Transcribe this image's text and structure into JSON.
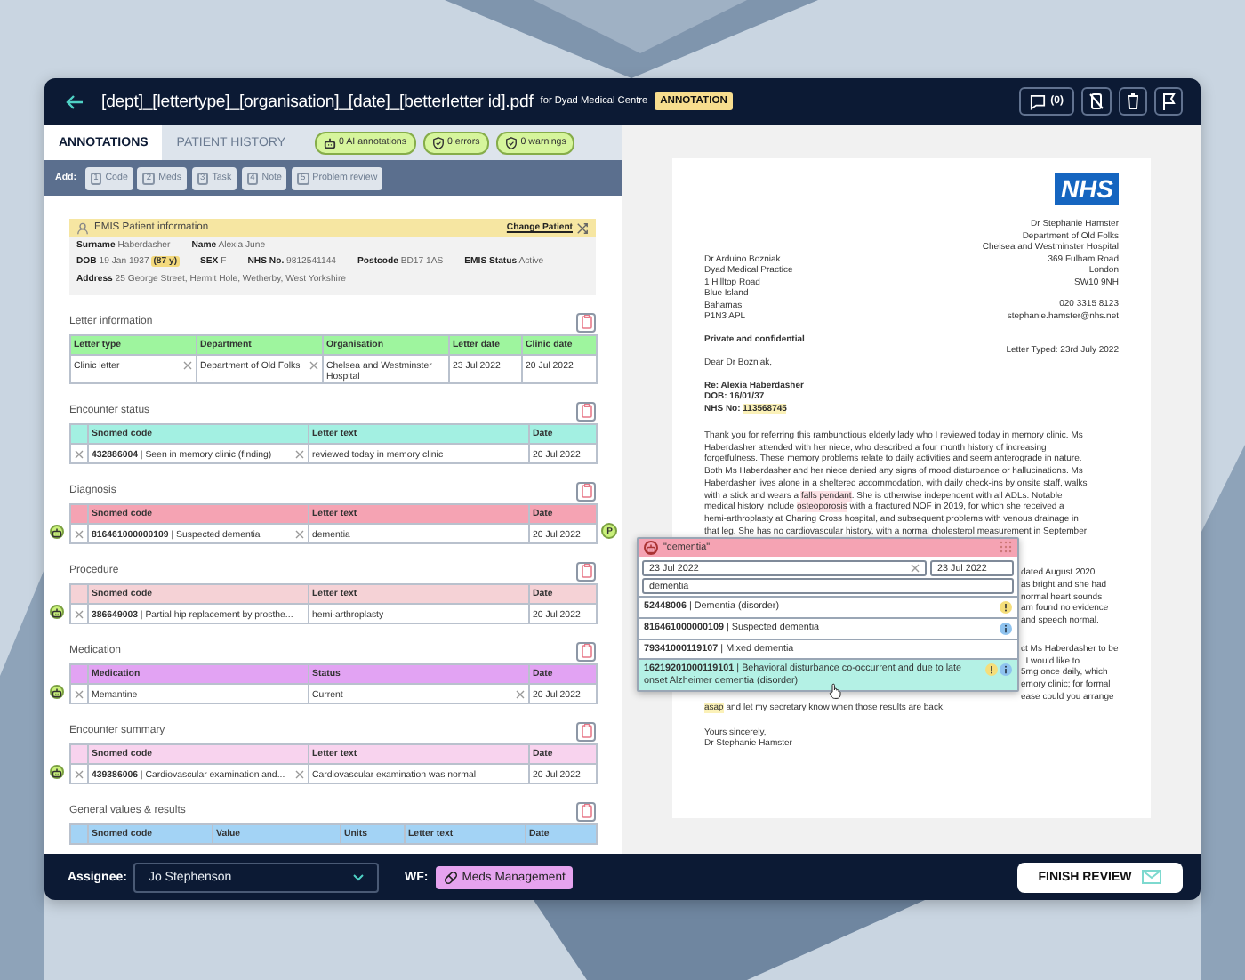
{
  "header": {
    "title": "[dept]_[lettertype]_[organisation]_[date]_[betterletter id].pdf",
    "subtitle": "for Dyad Medical Centre",
    "badge": "ANNOTATION",
    "comment_count": "(0)"
  },
  "tabs": [
    {
      "label": "ANNOTATIONS",
      "selected": true
    },
    {
      "label": "PATIENT HISTORY",
      "selected": false
    }
  ],
  "summary_pills": [
    {
      "kind": "ai",
      "label": "0 AI annotations"
    },
    {
      "kind": "error",
      "label": "0 errors"
    },
    {
      "kind": "warning",
      "label": "0 warnings"
    }
  ],
  "add_bar": {
    "label": "Add:",
    "items": [
      {
        "key": "1",
        "label": "Code"
      },
      {
        "key": "2",
        "label": "Meds"
      },
      {
        "key": "3",
        "label": "Task"
      },
      {
        "key": "4",
        "label": "Note"
      },
      {
        "key": "5",
        "label": "Problem review"
      }
    ]
  },
  "patient": {
    "title": "EMIS Patient information",
    "change": "Change Patient",
    "rows": [
      [
        {
          "label": "Surname",
          "value": "Haberdasher"
        },
        {
          "label": "Name",
          "value": "Alexia June"
        }
      ],
      [
        {
          "label": "DOB",
          "value": "19 Jan 1937",
          "badge": "(87 y)"
        },
        {
          "label": "SEX",
          "value": "F"
        },
        {
          "label": "NHS No.",
          "value": "9812541144"
        },
        {
          "label": "Postcode",
          "value": "BD17 1AS"
        },
        {
          "label": "EMIS Status",
          "value": "Active"
        }
      ],
      [
        {
          "label": "Address",
          "value": "25 George Street, Hermit Hole, Wetherby, West Yorkshire"
        }
      ]
    ]
  },
  "sections": [
    {
      "title": "Letter information",
      "kind": "letter",
      "color": "#9ef59e",
      "removable_rows": false,
      "ai_suggested": false,
      "columns": [
        "Letter type",
        "Department",
        "Organisation",
        "Letter date",
        "Clinic date"
      ],
      "rows": [
        [
          {
            "text": "Clinic letter",
            "clearable": true
          },
          {
            "text": "Department of Old Folks",
            "clearable": true
          },
          {
            "text": "Chelsea and Westminster Hospital"
          },
          {
            "text": "23 Jul 2022"
          },
          {
            "text": "20 Jul 2022"
          }
        ]
      ]
    },
    {
      "title": "Encounter status",
      "kind": "coded",
      "color": "#a3f0e2",
      "removable_rows": true,
      "ai_suggested": false,
      "columns": [
        "Snomed code",
        "Letter text",
        "Date"
      ],
      "rows": [
        [
          {
            "text": "**432886004** | Seen in memory clinic (finding)",
            "clearable": true
          },
          {
            "text": "reviewed today in memory clinic"
          },
          {
            "text": "20 Jul 2022"
          }
        ]
      ]
    },
    {
      "title": "Diagnosis",
      "kind": "coded",
      "color": "#f5a3b3",
      "removable_rows": true,
      "ai_suggested": true,
      "priority": "P",
      "columns": [
        "Snomed code",
        "Letter text",
        "Date"
      ],
      "rows": [
        [
          {
            "text": "**816461000000109** | Suspected dementia",
            "clearable": true
          },
          {
            "text": "dementia"
          },
          {
            "text": "20 Jul 2022"
          }
        ]
      ]
    },
    {
      "title": "Procedure",
      "kind": "coded",
      "color": "#f5d2d6",
      "removable_rows": true,
      "ai_suggested": true,
      "columns": [
        "Snomed code",
        "Letter text",
        "Date"
      ],
      "rows": [
        [
          {
            "text": "**386649003** | Partial hip replacement by prosthe..."
          },
          {
            "text": "hemi-arthroplasty"
          },
          {
            "text": "20 Jul 2022"
          }
        ]
      ]
    },
    {
      "title": "Medication",
      "kind": "coded",
      "color": "#e2a3f3",
      "removable_rows": true,
      "ai_suggested": true,
      "columns": [
        "Medication",
        "Status",
        "Date"
      ],
      "rows": [
        [
          {
            "text": "Memantine"
          },
          {
            "text": "Current",
            "clearable": true
          },
          {
            "text": "20 Jul 2022"
          }
        ]
      ]
    },
    {
      "title": "Encounter summary",
      "kind": "coded",
      "color": "#f8d3ee",
      "removable_rows": true,
      "ai_suggested": true,
      "columns": [
        "Snomed code",
        "Letter text",
        "Date"
      ],
      "rows": [
        [
          {
            "text": "**439386006** | Cardiovascular examination and...",
            "clearable": true
          },
          {
            "text": "Cardiovascular examination was normal"
          },
          {
            "text": "20 Jul 2022"
          }
        ]
      ]
    },
    {
      "title": "General values & results",
      "kind": "values",
      "color": "#a3d3f5",
      "removable_rows": true,
      "ai_suggested": false,
      "columns": [
        "Snomed code",
        "Value",
        "Units",
        "Letter text",
        "Date"
      ]
    }
  ],
  "document": {
    "logo": "NHS",
    "sender": [
      "Dr Stephanie Hamster",
      "Department of Old Folks",
      "Chelsea and Westminster Hospital",
      "369 Fulham Road",
      "London",
      "SW10 9NH"
    ],
    "contact": [
      "020 3315 8123",
      "stephanie.hamster@nhs.net"
    ],
    "recipient": [
      "Dr Arduino Bozniak",
      "Dyad Medical Practice",
      "1 Hilltop Road",
      "Blue Island",
      "Bahamas",
      "P1N3 APL"
    ],
    "private": "Private and confidential",
    "typed": "Letter Typed: 23rd July 2022",
    "greeting": "Dear Dr Bozniak,",
    "re": [
      {
        "label": "Re:",
        "value": "Alexia Haberdasher",
        "highlight": false
      },
      {
        "label": "DOB:",
        "value": "16/01/37",
        "highlight": false
      },
      {
        "label": "NHS No:",
        "value": "113568745",
        "highlight": true
      }
    ],
    "paragraphs": [
      [
        {
          "kind": "full",
          "parts": [
            {
              "text": "Thank you for referring this rambunctious elderly lady who I reviewed today in memory clinic. Ms"
            }
          ]
        },
        {
          "kind": "full",
          "parts": [
            {
              "text": "Haberdasher attended with her niece, who described a four month history of increasing"
            }
          ]
        },
        {
          "kind": "full",
          "parts": [
            {
              "text": "forgetfulness. These memory problems relate to daily activities and seem anterograde in nature."
            }
          ]
        },
        {
          "kind": "full",
          "parts": [
            {
              "text": "Both Ms Haberdasher and her niece denied any signs of mood disturbance or hallucinations. Ms"
            }
          ]
        },
        {
          "kind": "full",
          "parts": [
            {
              "text": "Haberdasher lives alone in a sheltered accommodation, with daily check-ins by onsite staff, walks"
            }
          ]
        },
        {
          "kind": "full",
          "parts": [
            {
              "text": "with a stick and wears a "
            },
            {
              "text": "falls pendant",
              "color": "#fde2e6"
            },
            {
              "text": ". She is otherwise independent with all ADLs. Notable"
            }
          ]
        },
        {
          "kind": "full",
          "parts": [
            {
              "text": "medical history include "
            },
            {
              "text": "osteoporosis",
              "color": "#fde2e6"
            },
            {
              "text": " with a fractured NOF in 2019, for which she received a"
            }
          ]
        },
        {
          "kind": "full",
          "parts": [
            {
              "text": "hemi-arthroplasty at Charing Cross hospital, and subsequent problems with venous drainage in"
            }
          ]
        },
        {
          "kind": "full",
          "parts": [
            {
              "text": "that leg. She has no cardiovascular history, with a normal cholesterol measurement in September"
            }
          ]
        },
        {
          "kind": "partial",
          "parts": [
            {
              "text": "dated August 2020"
            }
          ]
        },
        {
          "kind": "partial",
          "parts": [
            {
              "text": "as bright and she had"
            }
          ]
        },
        {
          "kind": "partial",
          "parts": [
            {
              "text": "normal heart sounds"
            }
          ]
        },
        {
          "kind": "partial",
          "parts": [
            {
              "text": "am found no evidence"
            }
          ]
        },
        {
          "kind": "partial",
          "parts": [
            {
              "text": "and speech normal."
            }
          ]
        }
      ],
      [
        {
          "kind": "partial",
          "parts": [
            {
              "text": "ct Ms Haberdasher to be"
            }
          ]
        },
        {
          "kind": "partial",
          "parts": [
            {
              "text": ". I would like to"
            }
          ]
        },
        {
          "kind": "partial",
          "parts": [
            {
              "text": "5mg once daily, which"
            }
          ]
        },
        {
          "kind": "partial",
          "parts": [
            {
              "text": "emory clinic; for formal"
            }
          ]
        },
        {
          "kind": "partial",
          "parts": [
            {
              "text": "ease could you arrange"
            }
          ]
        },
        {
          "kind": "full",
          "parts": [
            {
              "text": "asap",
              "color": "#fbf1b8"
            },
            {
              "text": " and let my secretary know when those results are back."
            }
          ]
        }
      ]
    ],
    "sign_off": [
      "Yours sincerely,",
      "Dr Stephanie Hamster"
    ]
  },
  "popup": {
    "title": "\"dementia\"",
    "dates": [
      {
        "value": "23 Jul 2022",
        "clearable": true
      },
      {
        "value": "23 Jul 2022",
        "clearable": false
      }
    ],
    "search": "dementia",
    "options": [
      {
        "text": "**52448006** | Dementia (disorder)",
        "warning": true,
        "info": false,
        "selected": false
      },
      {
        "text": "**816461000000109** | Suspected dementia",
        "warning": false,
        "info": true,
        "selected": false
      },
      {
        "text": "**79341000119107** | Mixed dementia",
        "warning": false,
        "info": false,
        "selected": false
      },
      {
        "text": "**16219201000119101** | Behavioral disturbance co-occurrent and due to late onset Alzheimer dementia (disorder)",
        "warning": true,
        "info": true,
        "selected": true
      }
    ]
  },
  "bottom_bar": {
    "assignee_label": "Assignee:",
    "assignee": "Jo Stephenson",
    "workflow_label": "WF:",
    "workflow": "Meds Management",
    "finish": "FINISH REVIEW"
  }
}
